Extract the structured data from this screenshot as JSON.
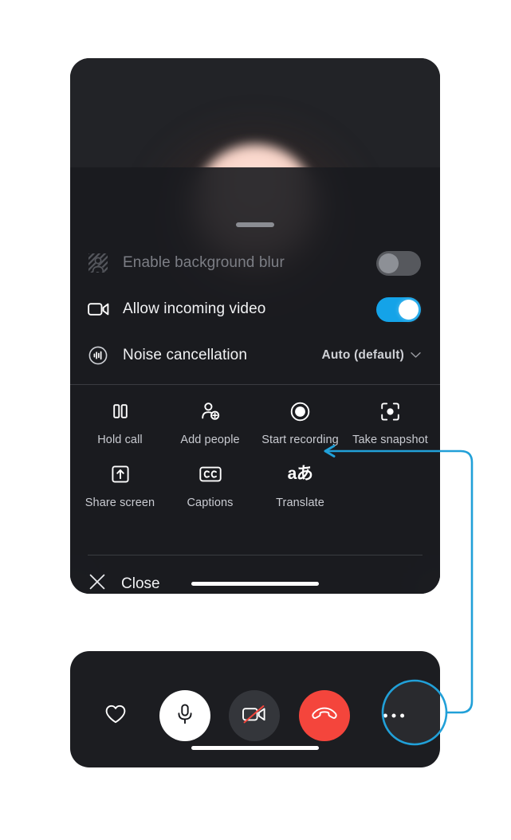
{
  "sheet": {
    "grab_handle": "drag-handle",
    "settings": [
      {
        "icon": "background-blur-icon",
        "label": "Enable background blur",
        "control": "toggle",
        "state": "off",
        "disabled": true
      },
      {
        "icon": "video-camera-icon",
        "label": "Allow incoming video",
        "control": "toggle",
        "state": "on",
        "disabled": false
      },
      {
        "icon": "noise-cancellation-icon",
        "label": "Noise cancellation",
        "control": "select",
        "value": "Auto (default)",
        "chevron": "chevron-down-icon"
      }
    ],
    "actions": [
      {
        "icon": "pause-icon",
        "label": "Hold call"
      },
      {
        "icon": "add-person-icon",
        "label": "Add people"
      },
      {
        "icon": "record-icon",
        "label": "Start recording"
      },
      {
        "icon": "snapshot-icon",
        "label": "Take snapshot"
      },
      {
        "icon": "share-screen-icon",
        "label": "Share screen"
      },
      {
        "icon": "captions-cc-icon",
        "label": "Captions"
      },
      {
        "icon": "translate-icon",
        "label": "Translate",
        "glyph": "aあ"
      }
    ],
    "close": {
      "icon": "close-x-icon",
      "label": "Close"
    }
  },
  "callbar": {
    "controls": [
      {
        "icon": "heart-icon",
        "name": "reaction-heart-button",
        "state": "default"
      },
      {
        "icon": "microphone-icon",
        "name": "mic-button",
        "state": "active"
      },
      {
        "icon": "video-off-icon",
        "name": "video-button",
        "state": "off"
      },
      {
        "icon": "hangup-phone-icon",
        "name": "hangup-button",
        "state": "danger"
      },
      {
        "icon": "more-dots-icon",
        "name": "more-options-button",
        "state": "highlighted"
      }
    ]
  },
  "annotation": {
    "highlight_target": "more-options-button",
    "arrow_target": "Translate",
    "color": "#21A0D8"
  },
  "colors": {
    "panel_bg": "#1C1D21",
    "toggle_on": "#14A3E8",
    "toggle_off": "#56585D",
    "hangup_red": "#F4453C",
    "annotation_blue": "#21A0D8",
    "label_dim": "#7C7E85",
    "label": "#F1F2F4"
  }
}
